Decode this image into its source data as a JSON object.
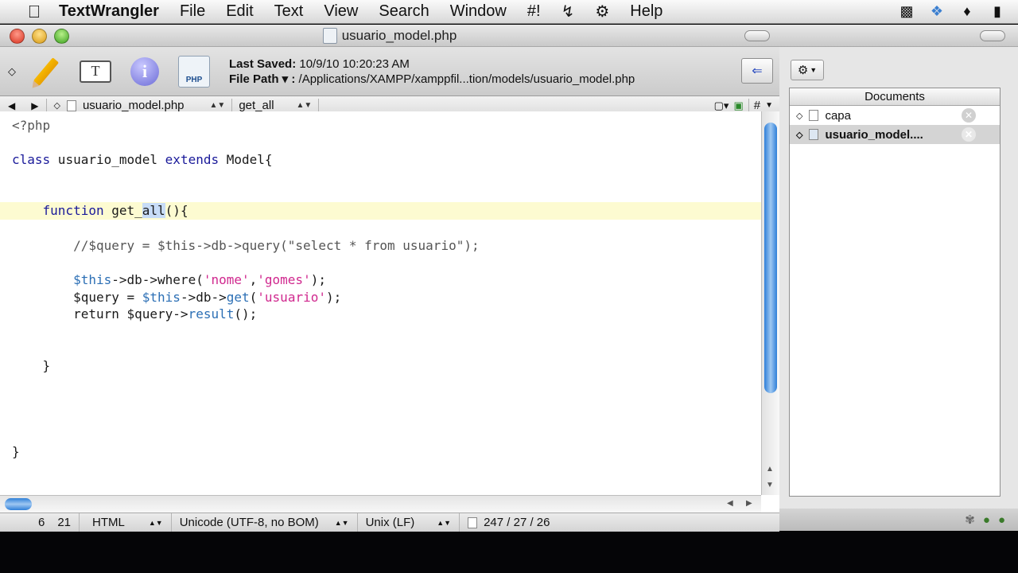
{
  "menubar": {
    "app": "TextWrangler",
    "items": [
      "File",
      "Edit",
      "Text",
      "View",
      "Search",
      "Window",
      "#!",
      "Help"
    ],
    "icons": [
      "script-icon",
      "gear-icon",
      "camera-icon",
      "dropbox-icon",
      "evernote-icon",
      "battery-icon"
    ]
  },
  "window": {
    "title": "usuario_model.php"
  },
  "toolbar": {
    "last_saved_label": "Last Saved:",
    "last_saved_value": "10/9/10 10:20:23 AM",
    "file_path_label": "File Path ▾ :",
    "file_path_value": "/Applications/XAMPP/xamppfil...tion/models/usuario_model.php",
    "text_options_glyph": "T",
    "info_glyph": "i",
    "php_badge": "PHP"
  },
  "navbar": {
    "file_popup": "usuario_model.php",
    "function_popup": "get_all",
    "hash": "#"
  },
  "editor": {
    "lines": {
      "l1": "<?php",
      "l3_a": "class",
      "l3_b": " usuario_model ",
      "l3_c": "extends",
      "l3_d": " Model{",
      "l6_a": "    ",
      "l6_b": "function",
      "l6_c": " get_",
      "l6_d": "all",
      "l6_e": "(){",
      "l8": "        //$query = $this->db->query(\"select * from usuario\");",
      "l10_a": "        ",
      "l10_b": "$this",
      "l10_c": "->db->where(",
      "l10_d": "'nome'",
      "l10_e": ",",
      "l10_f": "'gomes'",
      "l10_g": ");",
      "l11_a": "        $query = ",
      "l11_b": "$this",
      "l11_c": "->db->",
      "l11_d": "get",
      "l11_e": "(",
      "l11_f": "'usuario'",
      "l11_g": ");",
      "l12_a": "        return $query->",
      "l12_b": "result",
      "l12_c": "();",
      "l15": "    }",
      "l20": "}"
    }
  },
  "status": {
    "line": "6",
    "col": "21",
    "language": "HTML",
    "encoding": "Unicode (UTF-8, no BOM)",
    "line_endings": "Unix (LF)",
    "counts": "247 / 27 / 26"
  },
  "drawer": {
    "documents_header": "Documents",
    "documents": [
      {
        "name": "capa"
      },
      {
        "name": "usuario_model...."
      }
    ]
  },
  "colors": {
    "keyword": "#1a1a9a",
    "string": "#d0288e",
    "variable": "#2c6fb5",
    "current_line": "#fdfbd1",
    "selection": "#c7dcf7"
  }
}
